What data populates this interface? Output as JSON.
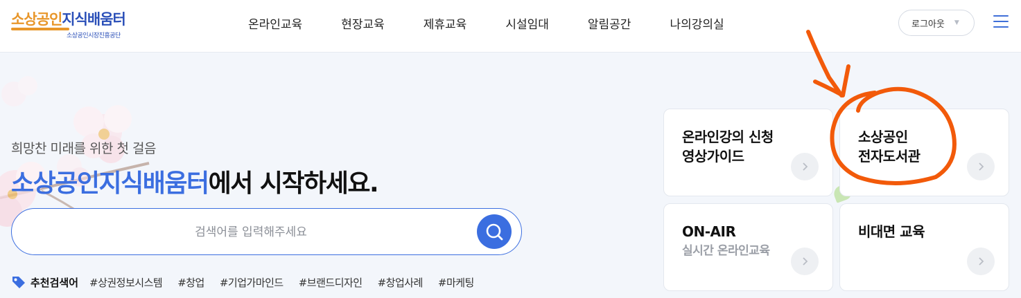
{
  "header": {
    "logo": {
      "main_part1": "소상공인",
      "main_part2": "지식배움터",
      "sub": "소상공인시장진흥공단"
    },
    "nav": [
      "온라인교육",
      "현장교육",
      "제휴교육",
      "시설임대",
      "알림공간",
      "나의강의실"
    ],
    "logout_label": "로그아웃"
  },
  "hero": {
    "tagline": "희망찬 미래를 위한 첫 걸음",
    "headline_highlight": "소상공인지식배움터",
    "headline_rest": "에서 시작하세요."
  },
  "search": {
    "placeholder": "검색어를 입력해주세요",
    "value": ""
  },
  "recommended": {
    "title": "추천검색어",
    "tags": [
      "#상권정보시스템",
      "#창업",
      "#기업가마인드",
      "#브랜드디자인",
      "#창업사례",
      "#마케팅"
    ]
  },
  "cards": [
    {
      "line1": "온라인강의 신청",
      "line2": "영상가이드"
    },
    {
      "line1": "소상공인",
      "line2": "전자도서관"
    },
    {
      "line1": "ON-AIR",
      "line2": "실시간 온라인교육"
    },
    {
      "line1": "비대면 교육",
      "line2": ""
    }
  ],
  "colors": {
    "brand_blue": "#3b6ee0",
    "brand_orange": "#e8962a",
    "annotation": "#f25a0a"
  },
  "icons": {
    "search": "magnifier-icon",
    "menu": "hamburger-menu-icon",
    "tag": "tag-icon",
    "card_arrow": "chevron-right-icon",
    "dropdown": "caret-down-icon"
  }
}
